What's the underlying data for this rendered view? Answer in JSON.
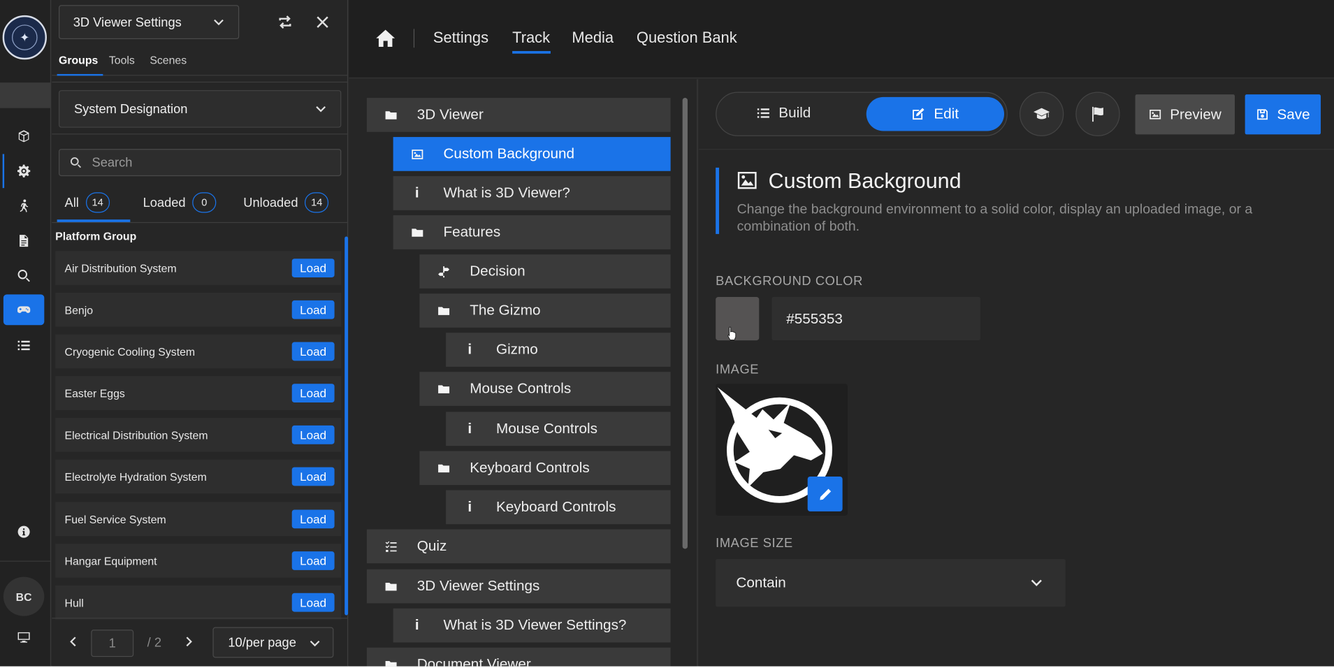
{
  "rail": {
    "avatar_initials": "BC",
    "icons": [
      "cube-icon",
      "gear-icon",
      "walking-person-icon",
      "document-icon",
      "search-icon",
      "gamepad-icon",
      "list-icon",
      "info-icon",
      "monitor-icon"
    ]
  },
  "left_panel": {
    "title_dropdown": "3D Viewer Settings",
    "tabs": [
      "Groups",
      "Tools",
      "Scenes"
    ],
    "group_dropdown": "System Designation",
    "search_placeholder": "Search",
    "filters": [
      {
        "label": "All",
        "count": "14"
      },
      {
        "label": "Loaded",
        "count": "0"
      },
      {
        "label": "Unloaded",
        "count": "14"
      }
    ],
    "group_title": "Platform Group",
    "load_label": "Load",
    "systems": [
      "Air Distribution System",
      "Benjo",
      "Cryogenic Cooling System",
      "Easter Eggs",
      "Electrical Distribution System",
      "Electrolyte Hydration System",
      "Fuel Service System",
      "Hangar Equipment",
      "Hull"
    ],
    "pager": {
      "current_page": "1",
      "total": "/ 2",
      "per_page": "10/per page"
    }
  },
  "topnav": {
    "items": [
      "Settings",
      "Track",
      "Media",
      "Question Bank"
    ],
    "active": "Track"
  },
  "tree": {
    "items": [
      {
        "label": "3D Viewer",
        "icon": "folder-icon"
      },
      {
        "label": "Custom Background",
        "icon": "image-icon",
        "selected": true
      },
      {
        "label": "What is 3D Viewer?",
        "icon": "info-icon"
      },
      {
        "label": "Features",
        "icon": "folder-icon"
      },
      {
        "label": "Decision",
        "icon": "decision-icon"
      },
      {
        "label": "The Gizmo",
        "icon": "folder-icon"
      },
      {
        "label": "Gizmo",
        "icon": "info-icon"
      },
      {
        "label": "Mouse Controls",
        "icon": "folder-icon"
      },
      {
        "label": "Mouse Controls",
        "icon": "info-icon"
      },
      {
        "label": "Keyboard Controls",
        "icon": "folder-icon"
      },
      {
        "label": "Keyboard Controls",
        "icon": "info-icon"
      },
      {
        "label": "Quiz",
        "icon": "quiz-list-icon"
      },
      {
        "label": "3D Viewer Settings",
        "icon": "folder-icon"
      },
      {
        "label": "What is 3D Viewer Settings?",
        "icon": "info-icon"
      },
      {
        "label": "Document Viewer",
        "icon": "folder-icon"
      }
    ]
  },
  "editor": {
    "build_label": "Build",
    "edit_label": "Edit",
    "preview_label": "Preview",
    "save_label": "Save",
    "title": "Custom Background",
    "description": "Change the background environment to a solid color, display an uploaded image, or a combination of both.",
    "bg_color_label": "BACKGROUND COLOR",
    "bg_color_value": "#555353",
    "image_label": "IMAGE",
    "image_size_label": "IMAGE SIZE",
    "image_size_value": "Contain"
  },
  "colors": {
    "accent": "#1a73e8",
    "swatch": "#555353"
  }
}
